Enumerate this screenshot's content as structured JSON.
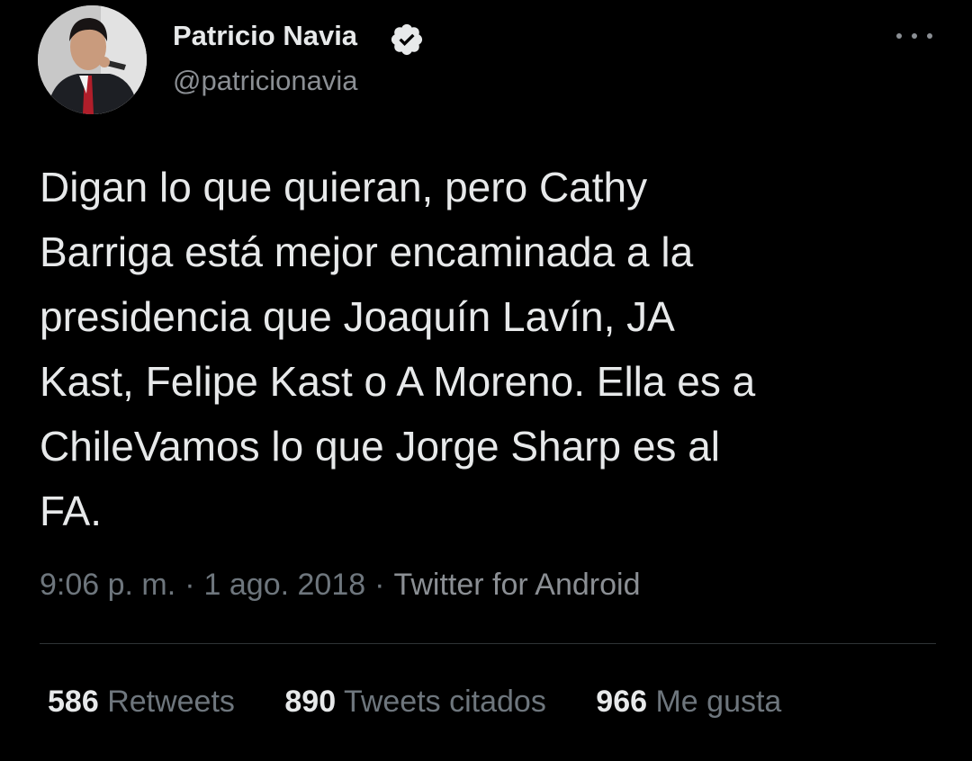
{
  "user": {
    "display_name": "Patricio Navia",
    "handle": "@patricionavia",
    "verified": true,
    "avatar_icon": "user-avatar-photo"
  },
  "tweet": {
    "text": "Digan lo que quieran, pero Cathy\nBarriga está mejor encaminada a la\npresidencia que Joaquín Lavín, JA\nKast, Felipe Kast o A Moreno. Ella es a\nChileVamos lo que Jorge Sharp es al\nFA.",
    "time": "9:06 p. m.",
    "separator": "·",
    "date": "1 ago. 2018",
    "source": "Twitter for Android"
  },
  "stats": {
    "retweets": {
      "count": "586",
      "label": "Retweets"
    },
    "quotes": {
      "count": "890",
      "label": "Tweets citados"
    },
    "likes": {
      "count": "966",
      "label": "Me gusta"
    }
  },
  "colors": {
    "background": "#000000",
    "primary_text": "#e7e9ea",
    "secondary_text": "#6e767d",
    "divider": "#2f3336"
  }
}
